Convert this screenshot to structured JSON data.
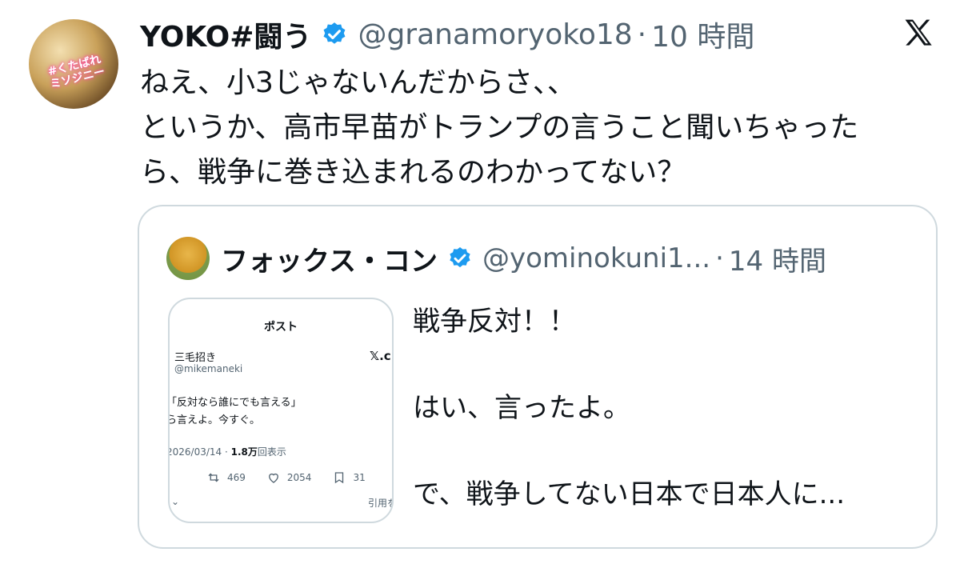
{
  "tweet": {
    "author_name": "YOKO#闘う",
    "handle": "@granamoryoko18",
    "separator": "·",
    "time": "10 時間",
    "avatar_text": [
      "#くたばれ",
      "ミソジニー"
    ],
    "lines": [
      "ねえ、小3じゃないんだからさ、、",
      "というか、高市早苗がトランプの言うこと聞いちゃった",
      "ら、戦争に巻き込まれるのわかってない？"
    ]
  },
  "quote": {
    "author_name": "フォックス・コン",
    "handle": "@yominokuni1...",
    "separator": "·",
    "time": "14 時間",
    "lines": [
      "戦争反対！！",
      "はい、言ったよ。",
      "で、戦争してない日本で日本人に..."
    ],
    "media": {
      "title": "ポスト",
      "user_name": "三毛招き",
      "user_handle": "@mikemaneki",
      "x_logo_text": "𝕏.c",
      "lines": [
        "「反対なら誰にでも言える」",
        "ら言えよ。今すぐ。"
      ],
      "date": "2026/03/14 · ",
      "views_count": "1.8万",
      "views_label": "回表示",
      "retweets": "469",
      "likes": "2054",
      "bookmarks": "31",
      "chevron": "⌄",
      "quote_label": "引用を"
    }
  },
  "colors": {
    "text": "#0f1419",
    "secondary": "#536471",
    "verified": "#1d9bf0",
    "border": "#cfd9de"
  },
  "icons": [
    "verified-badge-icon",
    "x-logo-icon",
    "retweet-icon",
    "like-icon",
    "bookmark-icon"
  ]
}
